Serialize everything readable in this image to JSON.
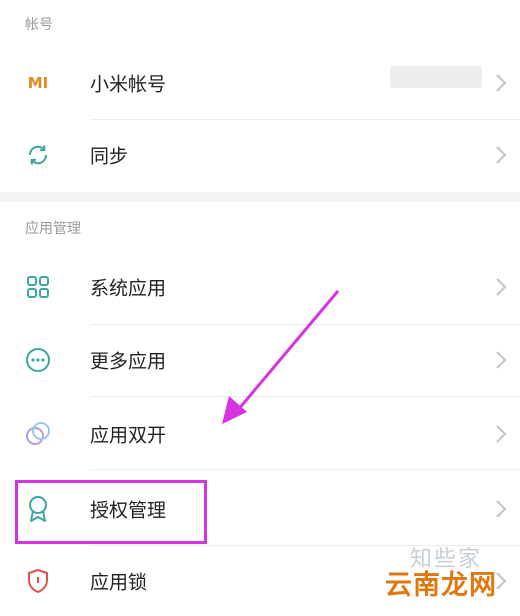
{
  "sections": {
    "account_header": "帐号",
    "apps_header": "应用管理"
  },
  "rows": {
    "mi_account": {
      "label": "小米帐号",
      "icon": "mi-logo-icon",
      "logo_text": "MI"
    },
    "sync": {
      "label": "同步",
      "icon": "sync-icon"
    },
    "system_apps": {
      "label": "系统应用",
      "icon": "grid-icon"
    },
    "more_apps": {
      "label": "更多应用",
      "icon": "more-dots-icon"
    },
    "dual_apps": {
      "label": "应用双开",
      "icon": "dual-circles-icon"
    },
    "permissions": {
      "label": "授权管理",
      "icon": "badge-icon"
    },
    "app_lock": {
      "label": "应用锁",
      "icon": "shield-icon"
    }
  },
  "annotations": {
    "arrow_color": "#d633e2",
    "highlight_color": "#d633e2"
  },
  "watermark": {
    "top": "知些家",
    "bottom": "云南龙网"
  },
  "colors": {
    "accent_teal": "#3aa7a0",
    "mi_orange": "#e38a1c",
    "text": "#222222",
    "header": "#9a9a9a"
  }
}
